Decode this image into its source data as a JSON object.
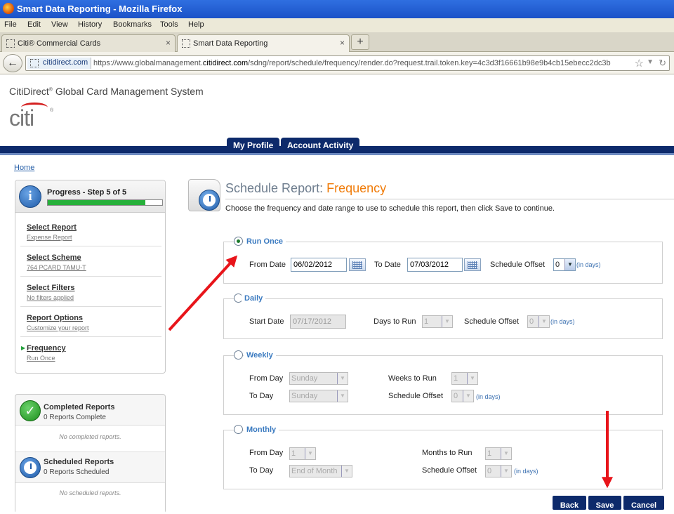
{
  "browser": {
    "window_title": "Smart Data Reporting - Mozilla Firefox",
    "menu": [
      "File",
      "Edit",
      "View",
      "History",
      "Bookmarks",
      "Tools",
      "Help"
    ],
    "tabs": [
      {
        "label": "Citi® Commercial Cards",
        "close": "×"
      },
      {
        "label": "Smart Data Reporting",
        "close": "×"
      }
    ],
    "new_tab": "+",
    "site_identity": "citidirect.com",
    "url_prefix": "https://www.globalmanagement.",
    "url_domain": "citidirect.com",
    "url_rest": "/sdng/report/schedule/frequency/render.do?request.trail.token.key=4c3d3f16661b98e9b4cb15ebecc2dc3b"
  },
  "header": {
    "system_name_pre": "CitiDirect",
    "system_name_reg": "®",
    "system_name_post": " Global Card Management System",
    "logo_text": "citi",
    "logo_reg": "®"
  },
  "nav": {
    "tabs": [
      "My Profile",
      "Account Activity"
    ],
    "home_link": "Home"
  },
  "progress": {
    "title": "Progress - Step 5 of 5",
    "fraction": 0.85,
    "bar_color": "#26b03a",
    "steps": [
      {
        "name": "Select Report",
        "sub": "Expense Report"
      },
      {
        "name": "Select Scheme",
        "sub": "764 PCARD TAMU-T"
      },
      {
        "name": "Select Filters",
        "sub": "No filters applied"
      },
      {
        "name": "Report Options",
        "sub": "Customize your report"
      },
      {
        "name": "Frequency",
        "sub": "Run Once"
      }
    ]
  },
  "reports": {
    "completed_title": "Completed Reports",
    "completed_sub": "0 Reports Complete",
    "completed_empty": "No completed reports.",
    "scheduled_title": "Scheduled Reports",
    "scheduled_sub": "0 Reports Scheduled",
    "scheduled_empty": "No scheduled reports."
  },
  "main": {
    "title_prefix": "Schedule Report: ",
    "title_highlight": "Frequency",
    "accent_color": "#f07c0a",
    "instructions": "Choose the frequency and date range to use to schedule this report, then click Save to continue."
  },
  "run_once": {
    "legend": "Run Once",
    "from_label": "From Date",
    "from_value": "06/02/2012",
    "to_label": "To Date",
    "to_value": "07/03/2012",
    "offset_label": "Schedule Offset",
    "offset_value": "0",
    "offset_unit": "(in days)"
  },
  "daily": {
    "legend": "Daily",
    "start_label": "Start Date",
    "start_value": "07/17/2012",
    "days_label": "Days to Run",
    "days_value": "1",
    "offset_label": "Schedule Offset",
    "offset_value": "0",
    "offset_unit": "(in days)"
  },
  "weekly": {
    "legend": "Weekly",
    "from_label": "From Day",
    "from_value": "Sunday",
    "to_label": "To Day",
    "to_value": "Sunday",
    "weeks_label": "Weeks to Run",
    "weeks_value": "1",
    "offset_label": "Schedule Offset",
    "offset_value": "0",
    "offset_unit": "(in days)"
  },
  "monthly": {
    "legend": "Monthly",
    "from_label": "From Day",
    "from_value": "1",
    "to_label": "To Day",
    "to_value": "End of Month",
    "months_label": "Months to Run",
    "months_value": "1",
    "offset_label": "Schedule Offset",
    "offset_value": "0",
    "offset_unit": "(in days)"
  },
  "buttons": {
    "back": "Back",
    "save": "Save",
    "cancel": "Cancel"
  },
  "annotation": {
    "arrow_color": "#e8141a"
  }
}
